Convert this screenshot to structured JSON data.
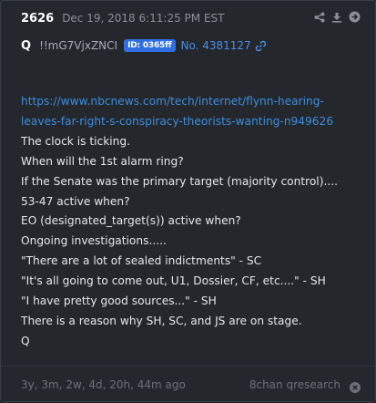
{
  "post": {
    "number": "2626",
    "date": "Dec 19, 2018 6:11:25 PM EST",
    "author": "Q",
    "tripcode": "!!mG7VjxZNCI",
    "id_badge": "ID: 0365ff",
    "post_no": "No. 4381127",
    "url_line1": "https://www.nbcnews.com/tech/internet/flynn-hearing-",
    "url_line2": "leaves-far-right-s-conspiracy-theorists-wanting-n949626",
    "lines": [
      "The clock is ticking.",
      "When will the 1st alarm ring?",
      "If the Senate was the primary target (majority control)....",
      "53-47 active when?",
      "EO (designated_target(s)) active when?",
      "Ongoing investigations.....",
      "\"There are a lot of sealed indictments\" - SC",
      "\"It's all going to come out, U1, Dossier, CF, etc....\" - SH",
      "\"I have pretty good sources...\" - SH",
      "There is a reason why SH, SC, and JS are on stage.",
      "Q"
    ]
  },
  "footer": {
    "age": "3y, 3m, 2w, 4d, 20h, 44m ago",
    "source": "8chan qresearch"
  },
  "icons": [
    "share-icon",
    "download-icon",
    "arrow-right-icon",
    "link-icon",
    "close-icon"
  ],
  "colors": {
    "background": "#24272c",
    "link": "#3d8fe0",
    "id_badge": "#2f6fe0",
    "text": "#e6e7e9",
    "muted": "#6d7177"
  }
}
